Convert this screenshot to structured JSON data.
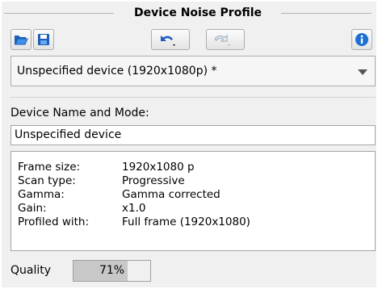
{
  "panel": {
    "title": "Device Noise Profile"
  },
  "toolbar": {
    "open_icon": "folder-open-icon",
    "save_icon": "floppy-save-icon",
    "undo_icon": "undo-arrow-icon",
    "redo_icon": "redo-arrow-icon",
    "info_icon": "info-icon"
  },
  "profile_select": {
    "value": "Unspecified device (1920x1080p) *"
  },
  "device": {
    "label": "Device Name and Mode:",
    "name_value": "Unspecified device"
  },
  "info": {
    "rows": [
      {
        "key": "Frame size:",
        "value": "1920x1080 p"
      },
      {
        "key": "Scan type:",
        "value": "Progressive"
      },
      {
        "key": "Gamma:",
        "value": "Gamma corrected"
      },
      {
        "key": "Gain:",
        "value": "x1.0"
      },
      {
        "key": "Profiled with:",
        "value": "Full frame (1920x1080)"
      }
    ]
  },
  "quality": {
    "label": "Quality",
    "percent_text": "71%",
    "value": 0.71
  },
  "colors": {
    "accent_blue": "#1e6fd0",
    "panel_bg": "#f0f0f0"
  }
}
